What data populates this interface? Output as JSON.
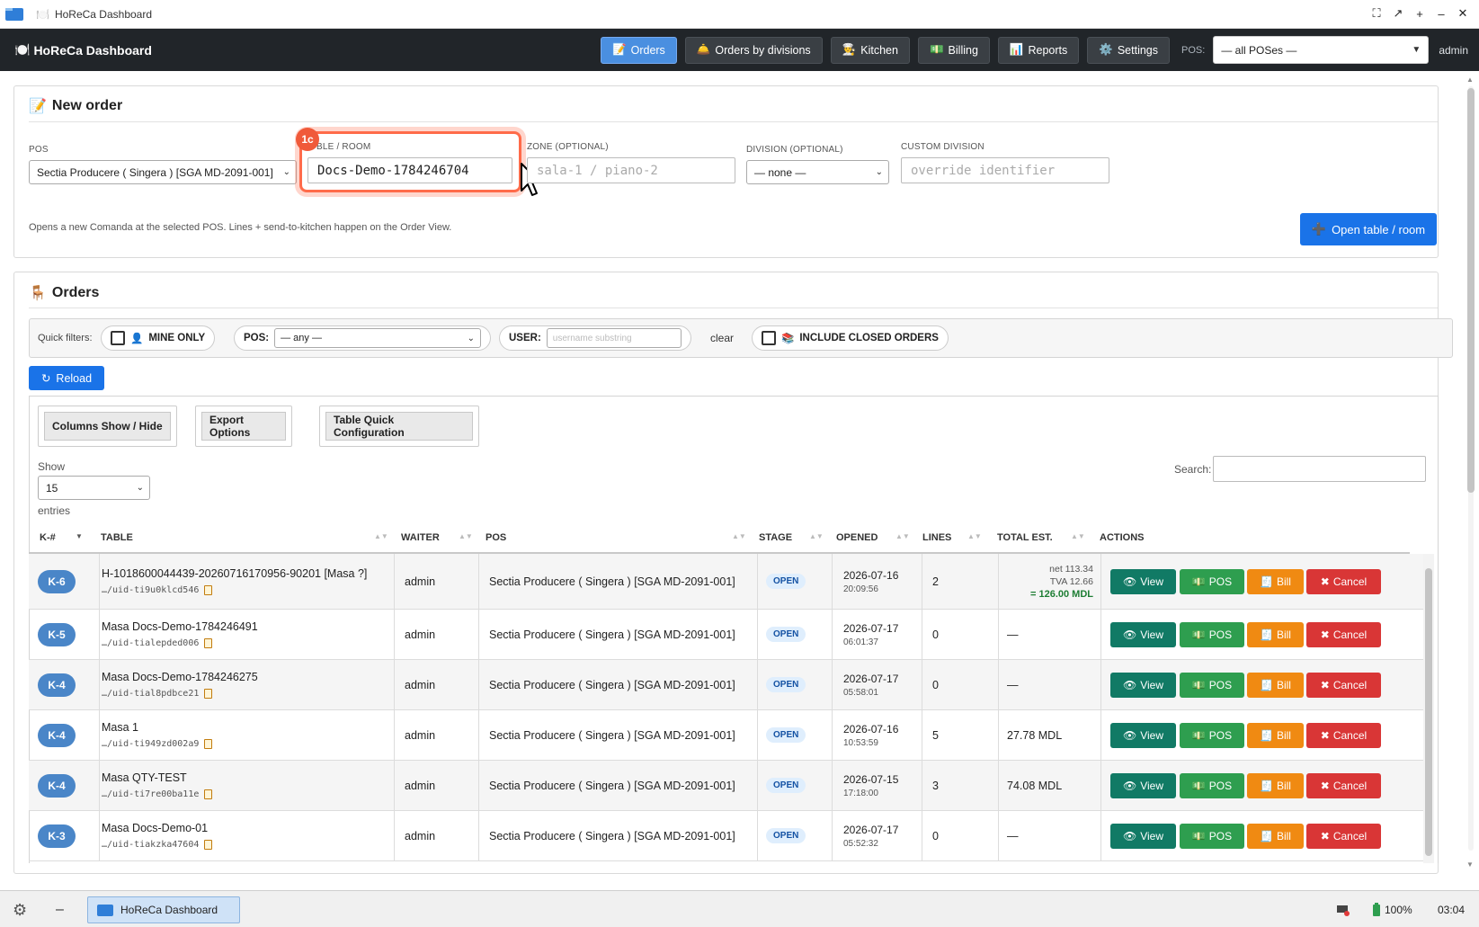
{
  "window": {
    "title": "HoReCa Dashboard",
    "controls": [
      "fullscreen",
      "restore",
      "new",
      "minimize",
      "close"
    ]
  },
  "navbar": {
    "brand": "HoReCa Dashboard",
    "brand_icon": "🍽️",
    "items": [
      {
        "icon": "📝",
        "label": "Orders",
        "active": true
      },
      {
        "icon": "🛎️",
        "label": "Orders by divisions",
        "active": false
      },
      {
        "icon": "👨‍🍳",
        "label": "Kitchen",
        "active": false
      },
      {
        "icon": "💵",
        "label": "Billing",
        "active": false
      },
      {
        "icon": "📊",
        "label": "Reports",
        "active": false
      },
      {
        "icon": "⚙️",
        "label": "Settings",
        "active": false
      }
    ],
    "pos_label": "POS:",
    "pos_value": "— all POSes —",
    "user": "admin"
  },
  "new_order": {
    "title_icon": "📝",
    "title": "New order",
    "pos_label": "POS",
    "pos_value": "Sectia Producere ( Singera ) [SGA MD-2091-001]",
    "table_label": "BLE / ROOM",
    "table_value": "Docs-Demo-1784246704",
    "zone_label": "ZONE (OPTIONAL)",
    "zone_placeholder": "sala-1 / piano-2",
    "division_label": "DIVISION (OPTIONAL)",
    "division_value": "— none —",
    "custom_division_label": "CUSTOM DIVISION",
    "custom_division_placeholder": "override identifier",
    "help": "Opens a new Comanda at the selected POS. Lines + send-to-kitchen happen on the Order View.",
    "open_button": "Open table / room",
    "open_button_icon": "➕",
    "step_badge": "1c"
  },
  "orders": {
    "title_icon": "🪑",
    "title": "Orders",
    "quick_filters_label": "Quick filters:",
    "mine_only_label": "MINE ONLY",
    "mine_only_icon": "👤",
    "pos_filter_label": "POS:",
    "pos_filter_value": "— any —",
    "user_filter_label": "USER:",
    "user_filter_placeholder": "username substring",
    "clear_label": "clear",
    "include_closed_label": "INCLUDE CLOSED ORDERS",
    "include_closed_icon": "📚",
    "reload_label": "Reload",
    "reload_icon": "↻",
    "tools": [
      "Columns Show / Hide",
      "Export Options",
      "Table Quick Configuration"
    ],
    "show_label": "Show",
    "show_value": "15",
    "entries_label": "entries",
    "search_label": "Search:",
    "columns": [
      "K-#",
      "TABLE",
      "WAITER",
      "POS",
      "STAGE",
      "OPENED",
      "LINES",
      "TOTAL EST.",
      "ACTIONS"
    ],
    "action_labels": {
      "view": "View",
      "pos": "POS",
      "bill": "Bill",
      "cancel": "Cancel"
    },
    "action_icons": {
      "view": "👁",
      "pos": "💵",
      "bill": "🧾",
      "cancel": "✖"
    },
    "rows": [
      {
        "k": "K-6",
        "table": "H-1018600044439-20260716170956-90201 [Masa ?]",
        "uid": "…/uid-ti9u0klcd546",
        "waiter": "admin",
        "pos": "Sectia Producere ( Singera ) [SGA MD-2091-001]",
        "stage": "OPEN",
        "date": "2026-07-16",
        "time": "20:09:56",
        "lines": "2",
        "net": "net 113.34",
        "tva": "TVA 12.66",
        "total": "= 126.00 MDL"
      },
      {
        "k": "K-5",
        "table": "Masa Docs-Demo-1784246491",
        "uid": "…/uid-tialepded006",
        "waiter": "admin",
        "pos": "Sectia Producere ( Singera ) [SGA MD-2091-001]",
        "stage": "OPEN",
        "date": "2026-07-17",
        "time": "06:01:37",
        "lines": "0",
        "total_plain": "—"
      },
      {
        "k": "K-4",
        "table": "Masa Docs-Demo-1784246275",
        "uid": "…/uid-tial8pdbce21",
        "waiter": "admin",
        "pos": "Sectia Producere ( Singera ) [SGA MD-2091-001]",
        "stage": "OPEN",
        "date": "2026-07-17",
        "time": "05:58:01",
        "lines": "0",
        "total_plain": "—"
      },
      {
        "k": "K-4",
        "table": "Masa 1",
        "uid": "…/uid-ti949zd002a9",
        "waiter": "admin",
        "pos": "Sectia Producere ( Singera ) [SGA MD-2091-001]",
        "stage": "OPEN",
        "date": "2026-07-16",
        "time": "10:53:59",
        "lines": "5",
        "total_plain": "27.78 MDL"
      },
      {
        "k": "K-4",
        "table": "Masa QTY-TEST",
        "uid": "…/uid-ti7re00ba11e",
        "waiter": "admin",
        "pos": "Sectia Producere ( Singera ) [SGA MD-2091-001]",
        "stage": "OPEN",
        "date": "2026-07-15",
        "time": "17:18:00",
        "lines": "3",
        "total_plain": "74.08 MDL"
      },
      {
        "k": "K-3",
        "table": "Masa Docs-Demo-01",
        "uid": "…/uid-tiakzka47604",
        "waiter": "admin",
        "pos": "Sectia Producere ( Singera ) [SGA MD-2091-001]",
        "stage": "OPEN",
        "date": "2026-07-17",
        "time": "05:52:32",
        "lines": "0",
        "total_plain": "—"
      }
    ]
  },
  "taskbar": {
    "app_label": "HoReCa Dashboard",
    "battery": "100%",
    "clock": "03:04"
  }
}
